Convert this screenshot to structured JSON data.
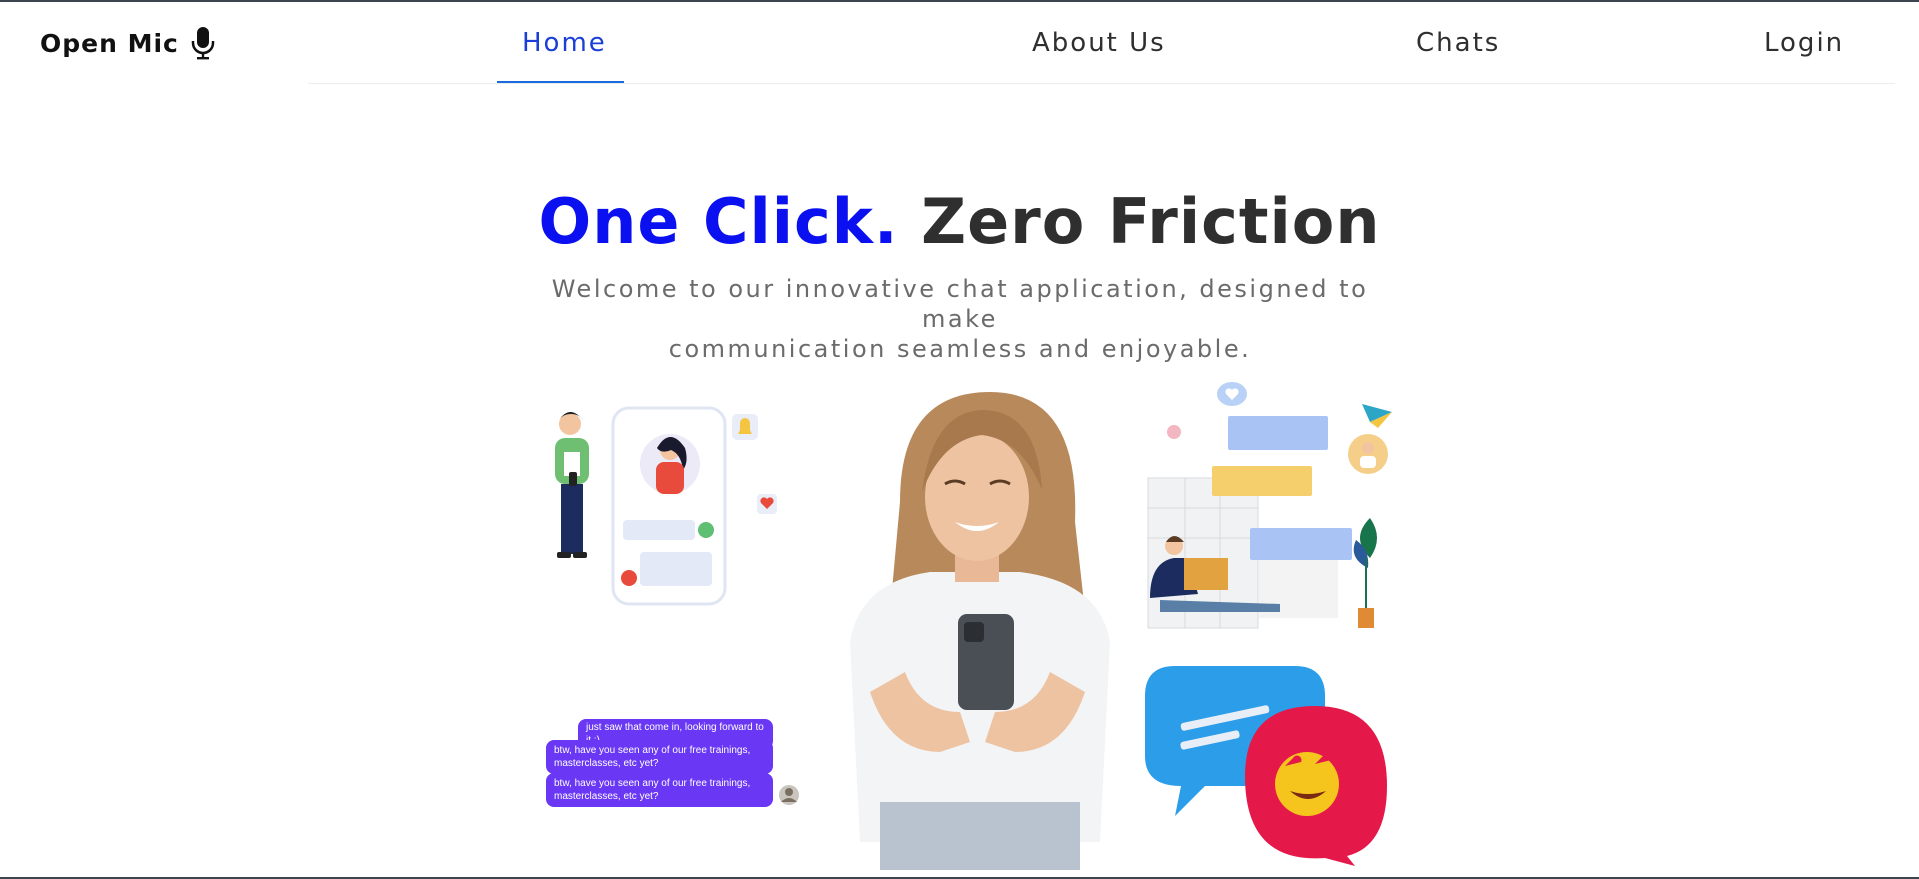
{
  "brand": {
    "name": "Open Mic",
    "icon": "microphone-icon"
  },
  "nav": {
    "items": [
      {
        "label": "Home",
        "active": true
      },
      {
        "label": "About Us",
        "active": false
      },
      {
        "label": "Chats",
        "active": false
      },
      {
        "label": "Login",
        "active": false
      }
    ]
  },
  "hero": {
    "headline_accent": "One Click.",
    "headline_rest": "Zero Friction",
    "subtitle_line1": "Welcome to our innovative chat application, designed to make",
    "subtitle_line2": "communication seamless and enjoyable."
  },
  "chat_snippet": {
    "messages": [
      "just saw that come in, looking forward to it :)",
      "btw, have you seen any of our free trainings, masterclasses, etc yet?",
      "btw, have you seen any of our free trainings, masterclasses, etc yet?"
    ]
  },
  "colors": {
    "accent": "#0a10f0",
    "nav_active": "#1a3fd6",
    "chat_bubble": "#6a38f5"
  }
}
